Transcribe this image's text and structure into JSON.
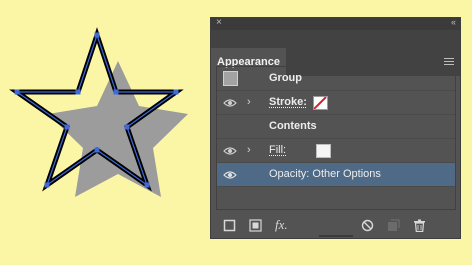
{
  "panel": {
    "close_glyph": "×",
    "collapse_glyph": "‹‹",
    "tab_title": "Appearance",
    "menu_icon": "panel-menu-icon"
  },
  "rows": {
    "group_label": "Group",
    "stroke_label": "Stroke:",
    "contents_label": "Contents",
    "fill_label": "Fill:",
    "opacity_label": "Opacity:",
    "opacity_value": "Other Options"
  },
  "toolbar": {
    "fx_label": "fx."
  },
  "colors": {
    "canvas_bg": "#fbf6a6",
    "panel_bg": "#535353",
    "selection": "#4e6a86",
    "stroke_swatch_slash": "#d2232a",
    "anchor": "#3f6ad8"
  }
}
